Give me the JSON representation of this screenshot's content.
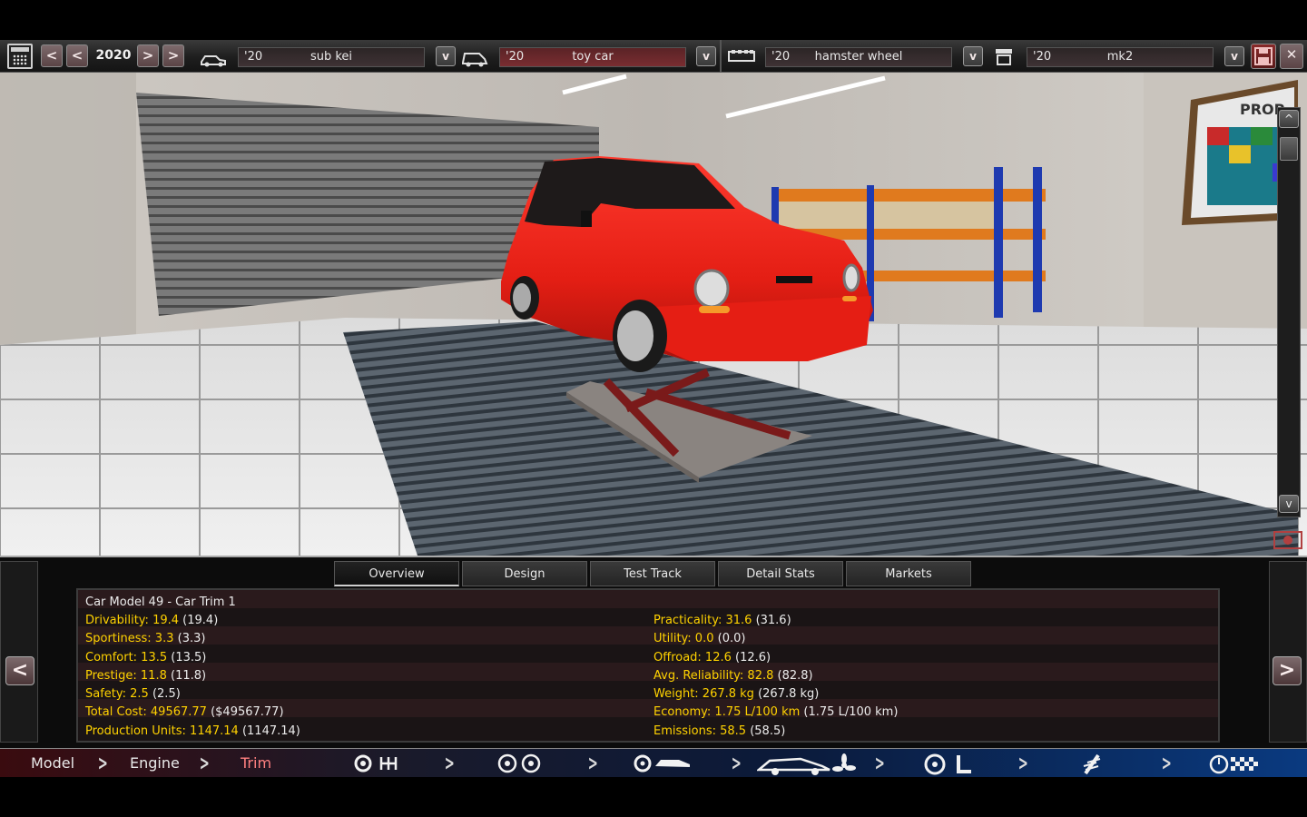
{
  "toolbar": {
    "year": "2020",
    "prev_label": "<",
    "next_label": ">",
    "dropdown_label": "v",
    "selectors": [
      {
        "year": "'20",
        "name": "sub kei"
      },
      {
        "year": "'20",
        "name": "toy car"
      },
      {
        "year": "'20",
        "name": "hamster wheel"
      },
      {
        "year": "'20",
        "name": "mk2"
      }
    ]
  },
  "scene": {
    "wall_sign": "PROP",
    "scroll_up": "^",
    "scroll_down": "v"
  },
  "panel": {
    "tabs": [
      "Overview",
      "Design",
      "Test Track",
      "Detail Stats",
      "Markets"
    ],
    "active_tab": "Overview",
    "page_prev": "<",
    "page_next": ">",
    "title": "Car Model 49 - Car Trim 1",
    "left_stats": [
      {
        "label": "Drivability: 19.4",
        "extra": "(19.4)"
      },
      {
        "label": "Sportiness: 3.3",
        "extra": "(3.3)"
      },
      {
        "label": "Comfort: 13.5",
        "extra": "(13.5)"
      },
      {
        "label": "Prestige: 11.8",
        "extra": "(11.8)"
      },
      {
        "label": "Safety: 2.5",
        "extra": "(2.5)"
      },
      {
        "label": "Total Cost: 49567.77",
        "extra": "($49567.77)"
      },
      {
        "label": "Production Units: 1147.14",
        "extra": "(1147.14)"
      }
    ],
    "right_stats": [
      {
        "label": "Practicality: 31.6",
        "extra": "(31.6)"
      },
      {
        "label": "Utility: 0.0",
        "extra": "(0.0)"
      },
      {
        "label": "Offroad: 12.6",
        "extra": "(12.6)"
      },
      {
        "label": "Avg. Reliability: 82.8",
        "extra": "(82.8)"
      },
      {
        "label": "Weight: 267.8 kg",
        "extra": "(267.8 kg)"
      },
      {
        "label": "Economy: 1.75 L/100 km",
        "extra": "(1.75 L/100 km)"
      },
      {
        "label": "Emissions: 58.5",
        "extra": "(58.5)"
      }
    ]
  },
  "nav": {
    "steps": [
      "Model",
      "Engine",
      "Trim"
    ],
    "current": "Trim",
    "icons": [
      "gearbox-icon",
      "wheels-icon",
      "body-icon",
      "aero-icon",
      "interior-icon",
      "suspension-icon",
      "testing-icon"
    ]
  }
}
